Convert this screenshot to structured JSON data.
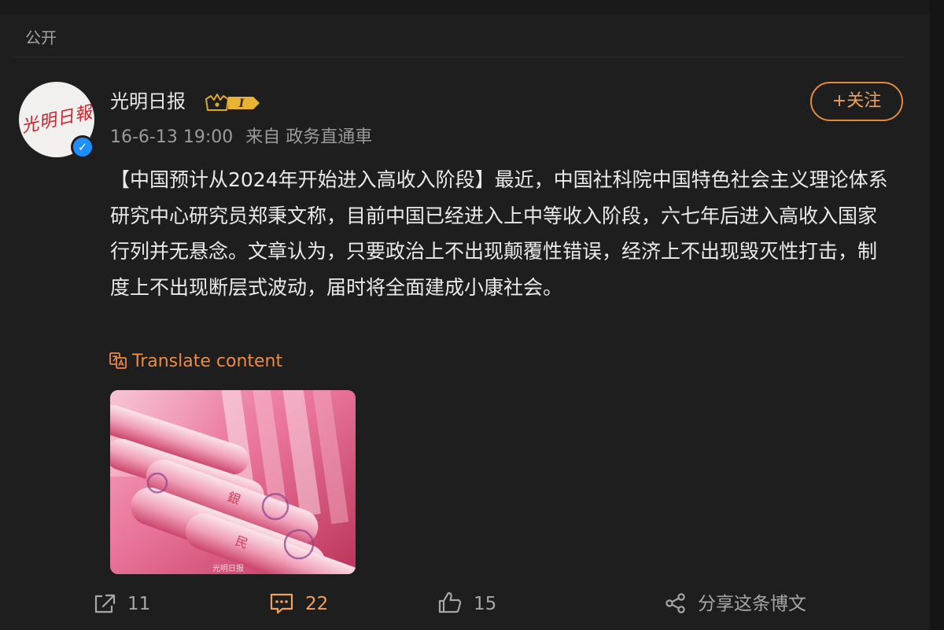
{
  "post": {
    "visibility": "公开",
    "author": {
      "name": "光明日报",
      "avatar_text": "光明日報",
      "member_level": "I"
    },
    "meta": {
      "timestamp": "16-6-13 19:00",
      "source": "来自 政务直通車"
    },
    "follow_label": "+关注",
    "text": "【中国预计从2024年开始进入高收入阶段】最近，中国社科院中国特色社会主义理论体系研究中心研究员郑秉文称，目前中国已经进入上中等收入阶段，六七年后进入高收入国家行列并无悬念。文章认为，只要政治上不出现颠覆性错误，经济上不出现毁灭性打击，制度上不出现断层式波动，届时将全面建成小康社会。",
    "translate_label": "Translate content",
    "image": {
      "watermark": "光明日报"
    },
    "actions": {
      "repost_count": "11",
      "comment_count": "22",
      "like_count": "15",
      "share_label": "分享这条博文"
    },
    "colors": {
      "accent": "#f0a15c",
      "verified": "#1f8fff",
      "background": "#1e1e1e"
    }
  }
}
